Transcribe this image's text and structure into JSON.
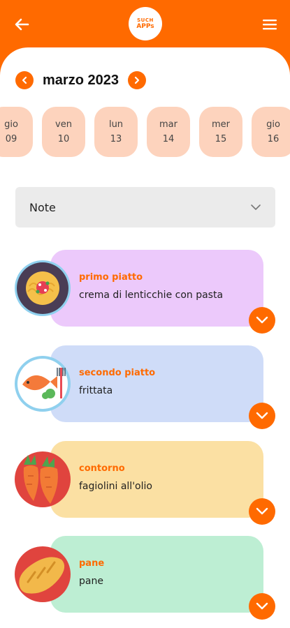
{
  "header": {
    "logo_line1": "SUCH",
    "logo_line2": "APPs",
    "back_icon": "back-arrow-icon",
    "menu_icon": "hamburger-menu-icon",
    "color": "#ff6a00"
  },
  "calendar": {
    "month": "marzo 2023",
    "days": [
      {
        "dow": "gio",
        "num": "09"
      },
      {
        "dow": "ven",
        "num": "10"
      },
      {
        "dow": "lun",
        "num": "13"
      },
      {
        "dow": "mar",
        "num": "14"
      },
      {
        "dow": "mer",
        "num": "15"
      },
      {
        "dow": "gio",
        "num": "16"
      }
    ]
  },
  "note": {
    "label": "Note"
  },
  "meals": [
    {
      "title": "primo piatto",
      "desc": "crema di lenticchie con pasta",
      "color": "#ecc9fb",
      "icon": "pasta-plate-icon"
    },
    {
      "title": "secondo piatto",
      "desc": "frittata",
      "color": "#cfdcf8",
      "icon": "fish-plate-icon"
    },
    {
      "title": "contorno",
      "desc": "fagiolini all'olio",
      "color": "#fbe0a3",
      "icon": "carrots-icon"
    },
    {
      "title": "pane",
      "desc": "pane",
      "color": "#bdeed3",
      "icon": "bread-icon"
    }
  ]
}
